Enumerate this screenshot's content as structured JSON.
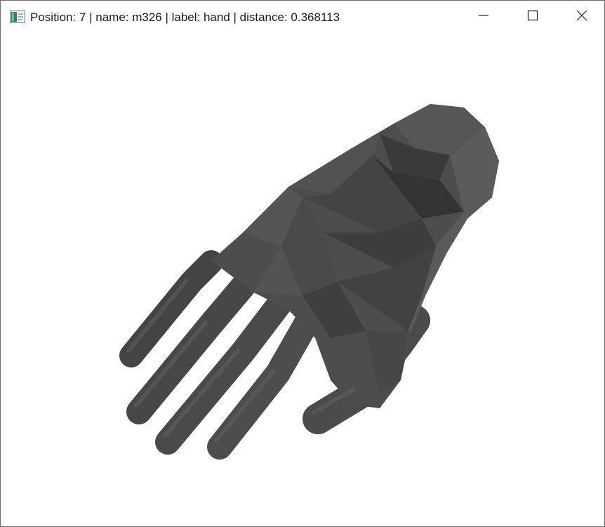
{
  "window": {
    "title": "Position: 7 | name: m326 | label: hand | distance: 0.368113",
    "app_icon": "app-window-icon",
    "controls": {
      "minimize_icon": "minimize-icon",
      "maximize_icon": "maximize-icon",
      "close_icon": "close-icon"
    }
  },
  "viewport": {
    "background_color": "#ffffff",
    "model_color": "#4a4a4a",
    "model_icon": "hand-mesh"
  }
}
